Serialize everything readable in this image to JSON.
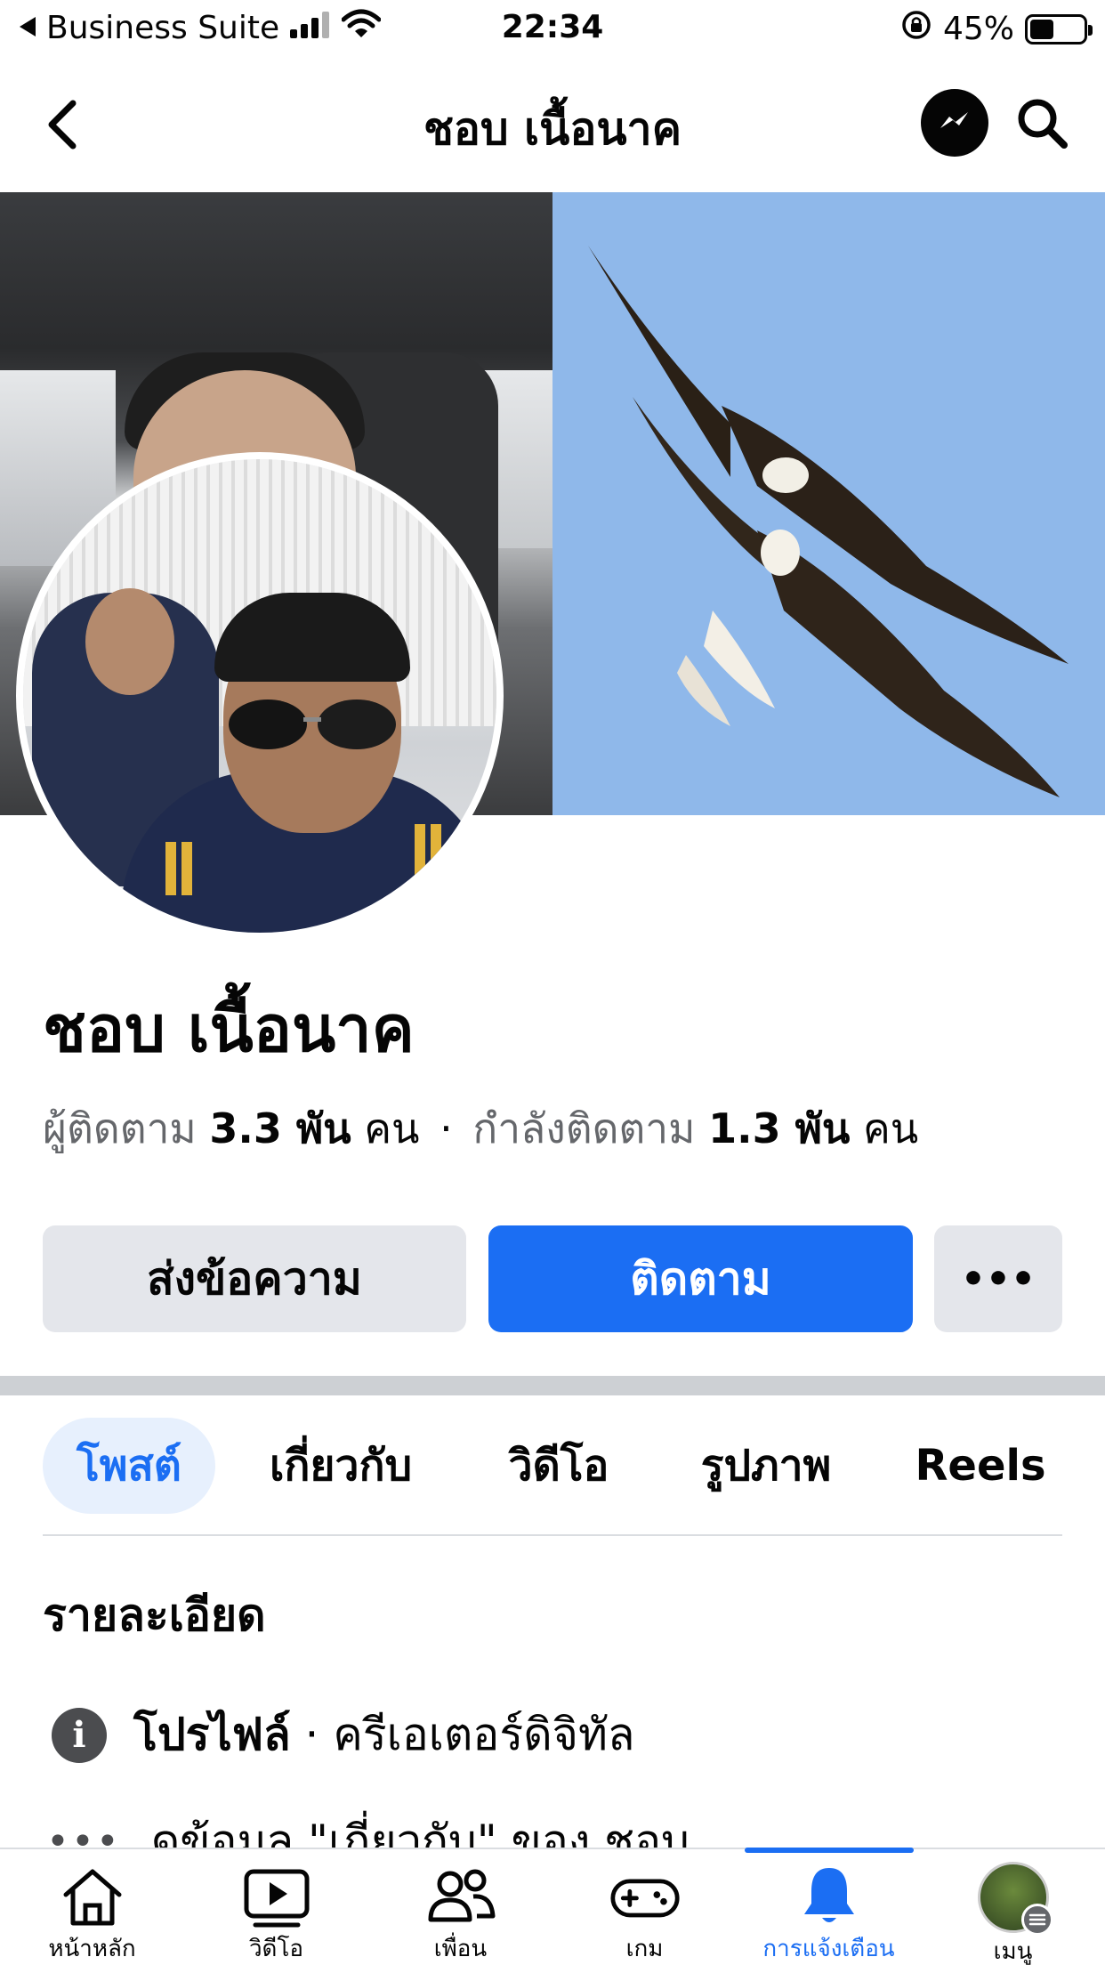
{
  "status_bar": {
    "back_app": "Business Suite",
    "time": "22:34",
    "battery": "45%",
    "battery_level": 0.45
  },
  "nav": {
    "title": "ชอบ เนื้อนาค"
  },
  "profile": {
    "name": "ชอบ เนื้อนาค",
    "followers_label": "ผู้ติดตาม",
    "followers_count": "3.3 พัน",
    "followers_unit": "คน",
    "separator": "·",
    "following_label": "กำลังติดตาม",
    "following_count": "1.3 พัน",
    "following_unit": "คน"
  },
  "actions": {
    "message_label": "ส่งข้อความ",
    "follow_label": "ติดตาม",
    "more_label": "•••"
  },
  "tabs": [
    {
      "label": "โพสต์",
      "active": true
    },
    {
      "label": "เกี่ยวกับ",
      "active": false
    },
    {
      "label": "วิดีโอ",
      "active": false
    },
    {
      "label": "รูปภาพ",
      "active": false
    },
    {
      "label": "Reels",
      "active": false
    }
  ],
  "details": {
    "title": "รายละเอียด",
    "profile_label": "โปรไฟล์",
    "profile_sep": " · ",
    "profile_category": "ครีเอเตอร์ดิจิทัล",
    "info_icon_glyph": "i",
    "more_info": "ดูข้อมูล \"เกี่ยวกับ\" ของ ชอบ",
    "more_icon_glyph": "•••"
  },
  "tabbar": {
    "items": [
      {
        "label": "หน้าหลัก",
        "icon": "home-icon"
      },
      {
        "label": "วิดีโอ",
        "icon": "video-icon"
      },
      {
        "label": "เพื่อน",
        "icon": "friends-icon"
      },
      {
        "label": "เกม",
        "icon": "gaming-icon"
      },
      {
        "label": "การแจ้งเตือน",
        "icon": "bell-icon",
        "active": true
      },
      {
        "label": "เมนู",
        "icon": "menu-avatar"
      }
    ]
  },
  "colors": {
    "accent": "#1b6ef3",
    "button_gray": "#e4e6eb",
    "secondary_text": "#65676b",
    "cover_sky": "#8fb8ea"
  }
}
